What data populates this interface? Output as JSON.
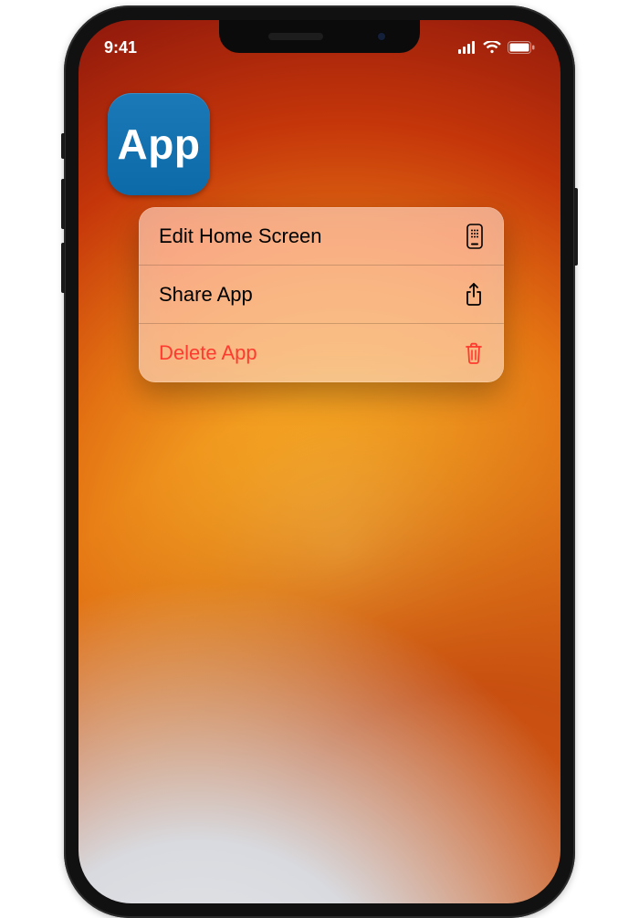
{
  "status_bar": {
    "time": "9:41"
  },
  "app_icon": {
    "label": "App"
  },
  "context_menu": {
    "items": [
      {
        "label": "Edit Home Screen",
        "icon": "home-grid-icon",
        "destructive": false
      },
      {
        "label": "Share App",
        "icon": "share-icon",
        "destructive": false
      },
      {
        "label": "Delete App",
        "icon": "trash-icon",
        "destructive": true
      }
    ]
  },
  "colors": {
    "destructive": "#ff3a2f",
    "app_icon_bg": "#1474b4"
  }
}
